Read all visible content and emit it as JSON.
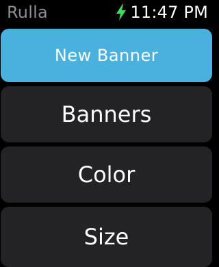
{
  "status_bar": {
    "app_name": "Rulla",
    "time": "11:47 PM",
    "charging_icon": "lightning-bolt-icon",
    "charging_color": "#3ddc5a"
  },
  "menu": {
    "items": [
      {
        "label": "New Banner",
        "style": "primary",
        "color": "#4ab0dd"
      },
      {
        "label": "Banners",
        "style": "default",
        "color": "#232325"
      },
      {
        "label": "Color",
        "style": "default",
        "color": "#232325"
      },
      {
        "label": "Size",
        "style": "default",
        "color": "#232325"
      }
    ]
  }
}
